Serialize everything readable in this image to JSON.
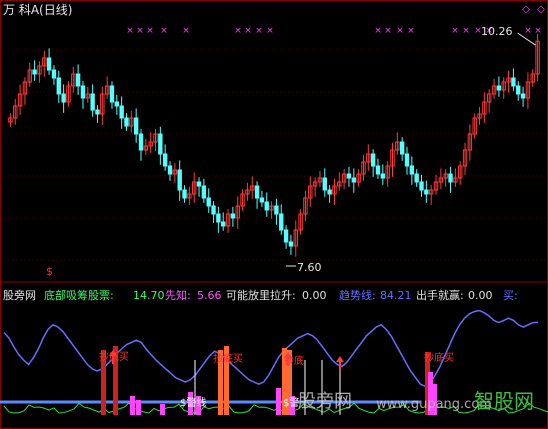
{
  "header": {
    "title": "万 科A(日线)"
  },
  "price_labels": {
    "high": "10.26",
    "low": "7.60",
    "top_signal": "$"
  },
  "indicator": {
    "name": "股旁网",
    "items": [
      {
        "label": "底部吸筹股票:",
        "value": "14.70",
        "color": "#33ff66"
      },
      {
        "label": "先知:",
        "value": "5.66",
        "color": "#ff55ff"
      },
      {
        "label": "可能放里拉升:",
        "value": "0.00",
        "color": "#e0e0e0"
      },
      {
        "label": "趋势线:",
        "value": "84.21",
        "color": "#6b6bff"
      },
      {
        "label": "出手就赢:",
        "value": "0.00",
        "color": "#e0e0e0"
      },
      {
        "label": "买:",
        "value": "",
        "color": "#6b6bff"
      }
    ]
  },
  "annotations": {
    "buy_labels": [
      "抄底买",
      "抄底买",
      "抄底",
      "抄底买"
    ],
    "bar_labels": [
      "$警线",
      "$警"
    ]
  },
  "watermark": {
    "left": "股旁网",
    "url": "www.gupang.com",
    "logo": "智股网"
  },
  "colors": {
    "up": "#ff3b3b",
    "down": "#54ffff",
    "trend": "#6b6bff",
    "magenta": "#ff44ff",
    "green": "#33dd33",
    "white": "#e6e6e6",
    "orange": "#ff6a33"
  },
  "chart_data": [
    {
      "type": "candlestick",
      "title": "万 科A(日线)",
      "high_marker": 10.26,
      "low_marker": 7.6,
      "ylim": [
        7.4,
        10.5
      ],
      "closes": [
        9.3,
        9.45,
        9.6,
        9.75,
        9.9,
        9.85,
        9.95,
        10.05,
        9.9,
        9.8,
        9.6,
        9.5,
        9.7,
        9.85,
        9.7,
        9.55,
        9.6,
        9.4,
        9.35,
        9.6,
        9.7,
        9.5,
        9.45,
        9.3,
        9.2,
        9.3,
        9.1,
        8.9,
        8.95,
        9.0,
        9.1,
        8.85,
        8.7,
        8.6,
        8.65,
        8.4,
        8.3,
        8.35,
        8.5,
        8.45,
        8.3,
        8.2,
        8.1,
        8.0,
        7.95,
        8.1,
        8.05,
        8.2,
        8.35,
        8.4,
        8.45,
        8.3,
        8.25,
        8.15,
        8.2,
        8.1,
        7.9,
        7.75,
        7.7,
        7.9,
        8.1,
        8.3,
        8.45,
        8.5,
        8.55,
        8.4,
        8.35,
        8.45,
        8.5,
        8.6,
        8.55,
        8.5,
        8.6,
        8.75,
        8.85,
        8.7,
        8.6,
        8.55,
        8.7,
        8.9,
        9.0,
        8.85,
        8.7,
        8.6,
        8.5,
        8.4,
        8.35,
        8.4,
        8.5,
        8.55,
        8.6,
        8.5,
        8.55,
        8.7,
        8.9,
        9.1,
        9.3,
        9.35,
        9.5,
        9.6,
        9.7,
        9.65,
        9.75,
        9.8,
        9.7,
        9.6,
        9.55,
        9.75,
        9.85,
        10.26
      ]
    },
    {
      "type": "line",
      "series": [
        {
          "name": "趋势线",
          "values": [
            75,
            70,
            62,
            55,
            50,
            46,
            52,
            60,
            70,
            78,
            82,
            80,
            76,
            70,
            64,
            58,
            52,
            46,
            42,
            40,
            42,
            46,
            50,
            56,
            60,
            64,
            66,
            68,
            66,
            60,
            55,
            50,
            46,
            42,
            38,
            34,
            32,
            30,
            32,
            36,
            42,
            48,
            54,
            58,
            56,
            52,
            48,
            44,
            40,
            36,
            32,
            30,
            28,
            30,
            36,
            44,
            52,
            58,
            62,
            66,
            70,
            72,
            74,
            72,
            68,
            62,
            56,
            50,
            46,
            44,
            48,
            54,
            60,
            66,
            72,
            76,
            80,
            82,
            78,
            72,
            64,
            56,
            48,
            40,
            34,
            28,
            26,
            30,
            36,
            44,
            54,
            64,
            74,
            82,
            88,
            92,
            94,
            95,
            93,
            90,
            86,
            84,
            86,
            88,
            86,
            82,
            80,
            82,
            84,
            84.21
          ]
        }
      ]
    }
  ]
}
